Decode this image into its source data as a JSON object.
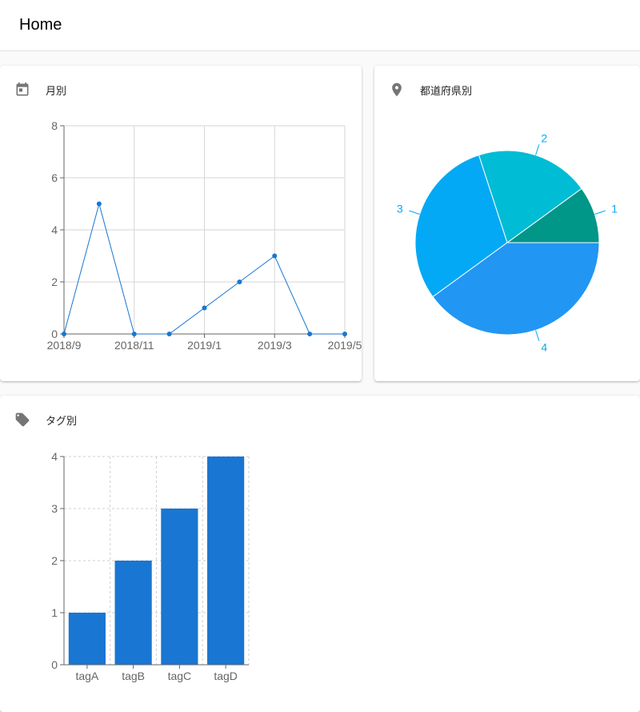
{
  "appbar": {
    "title": "Home"
  },
  "cards": {
    "monthly": {
      "title": "月別",
      "icon": "calendar-icon"
    },
    "prefecture": {
      "title": "都道府県別",
      "icon": "location-pin-icon"
    },
    "tag": {
      "title": "タグ別",
      "icon": "tag-icon"
    }
  },
  "colors": {
    "line": "#1976d2",
    "bar": "#1976d2",
    "pie": [
      "#009688",
      "#00bcd4",
      "#03a9f4",
      "#2196f3"
    ],
    "pieLabel": "#03a9f4",
    "icon": "#757575"
  },
  "chart_data": [
    {
      "type": "line",
      "x": [
        "2018/9",
        "2018/10",
        "2018/11",
        "2018/12",
        "2019/1",
        "2019/2",
        "2019/3",
        "2019/4",
        "2019/5"
      ],
      "xticks": [
        "2018/9",
        "2018/11",
        "2019/1",
        "2019/3",
        "2019/5"
      ],
      "values": [
        0,
        5,
        0,
        0,
        1,
        2,
        3,
        0,
        0
      ],
      "ylim": [
        0,
        8
      ],
      "yticks": [
        0,
        2,
        4,
        6,
        8
      ],
      "grid": true
    },
    {
      "type": "pie",
      "labels": [
        "1",
        "2",
        "3",
        "4"
      ],
      "values": [
        1,
        2,
        3,
        4
      ]
    },
    {
      "type": "bar",
      "categories": [
        "tagA",
        "tagB",
        "tagC",
        "tagD"
      ],
      "values": [
        1,
        2,
        3,
        4
      ],
      "ylim": [
        0,
        4
      ],
      "yticks": [
        0,
        1,
        2,
        3,
        4
      ],
      "grid": true
    }
  ]
}
